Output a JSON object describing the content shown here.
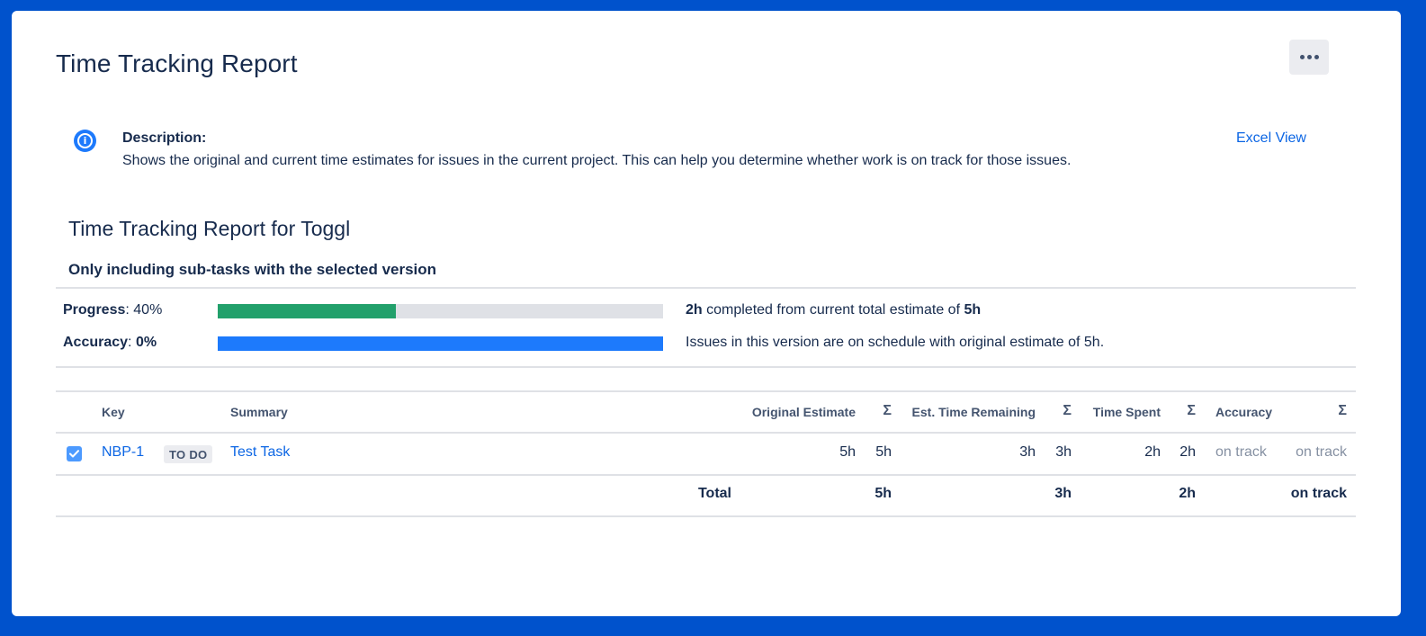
{
  "header": {
    "title": "Time Tracking Report",
    "more_icon": "more-horizontal-icon"
  },
  "description": {
    "icon": "info-icon",
    "label": "Description:",
    "text": "Shows the original and current time estimates for issues in the current project. This can help you determine whether work is on track for those issues.",
    "excel_link": "Excel View"
  },
  "report": {
    "title": "Time Tracking Report for Toggl",
    "subtitle": "Only including sub-tasks with the selected version",
    "progress": {
      "label": "Progress",
      "value_text": "40%",
      "percent": 40,
      "color": "#22a06b",
      "completed": "2h",
      "middle_text": " completed from current total estimate of ",
      "total": "5h"
    },
    "accuracy": {
      "label": "Accuracy",
      "value_text": "0%",
      "percent": 100,
      "color": "#1d7afc",
      "text": "Issues in this version are on schedule with original estimate of 5h."
    }
  },
  "table": {
    "columns": {
      "key": "Key",
      "summary": "Summary",
      "original_estimate": "Original Estimate",
      "est_remaining": "Est. Time Remaining",
      "time_spent": "Time Spent",
      "accuracy": "Accuracy",
      "sigma": "Σ"
    },
    "rows": [
      {
        "checked": true,
        "key": "NBP-1",
        "status": "TO DO",
        "summary": "Test Task",
        "original_estimate": "5h",
        "original_estimate_sum": "5h",
        "remaining": "3h",
        "remaining_sum": "3h",
        "spent": "2h",
        "spent_sum": "2h",
        "accuracy": "on track",
        "accuracy_sum": "on track"
      }
    ],
    "total": {
      "label": "Total",
      "original_estimate": "5h",
      "remaining": "3h",
      "spent": "2h",
      "accuracy": "on track"
    }
  }
}
